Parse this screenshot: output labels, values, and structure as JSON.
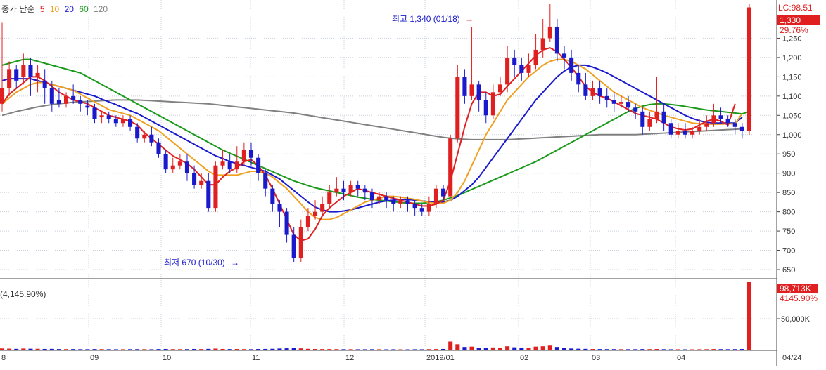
{
  "legend": {
    "label": "종가 단순",
    "periods": [
      {
        "text": "5",
        "color": "#e02020"
      },
      {
        "text": "10",
        "color": "#f0a020"
      },
      {
        "text": "20",
        "color": "#1a1acc"
      },
      {
        "text": "60",
        "color": "#1a9a1a"
      },
      {
        "text": "120",
        "color": "#808080"
      }
    ]
  },
  "annotations": {
    "high": "최고 1,340 (01/18)",
    "low": "최저 670 (10/30)"
  },
  "price_panel": {
    "lc_label": "LC:98.51",
    "current_price": "1,330",
    "current_change": "29.76%",
    "y_ticks": [
      "1,250",
      "1,200",
      "1,150",
      "1,100",
      "1,050",
      "1,000",
      "950",
      "900",
      "850",
      "800",
      "750",
      "700",
      "650"
    ]
  },
  "volume_panel": {
    "header": "(4,145.90%)",
    "current_volume": "98,713K",
    "current_ratio": "4145.90%",
    "y_tick": "50,000K"
  },
  "x_labels": [
    "8",
    "09",
    "10",
    "11",
    "12",
    "2019/01",
    "02",
    "03",
    "04",
    "04/24"
  ],
  "colors": {
    "up": "#e02020",
    "down": "#1a1acc",
    "ma5": "#e02020",
    "ma10": "#f0a020",
    "ma20": "#1a1acc",
    "ma60": "#1a9a1a",
    "ma120": "#808080",
    "grid": "#c8d0dc",
    "axis": "#444444",
    "price_box": "#e02020"
  },
  "chart_data": {
    "type": "candlestick",
    "y_range": [
      630,
      1340
    ],
    "volume_range": [
      0,
      100000
    ],
    "months": [
      "8",
      "09",
      "10",
      "11",
      "12",
      "2019/01",
      "02",
      "03",
      "04",
      "04/24"
    ],
    "candles": [
      [
        1080,
        1120,
        1290,
        1060,
        1800
      ],
      [
        1120,
        1170,
        1190,
        1100,
        1500
      ],
      [
        1170,
        1140,
        1180,
        1120,
        1200
      ],
      [
        1150,
        1180,
        1210,
        1130,
        1700
      ],
      [
        1180,
        1150,
        1200,
        1100,
        1400
      ],
      [
        1150,
        1160,
        1180,
        1110,
        1300
      ],
      [
        1140,
        1120,
        1170,
        1080,
        1100
      ],
      [
        1120,
        1080,
        1140,
        1060,
        1200
      ],
      [
        1090,
        1080,
        1120,
        1070,
        900
      ],
      [
        1080,
        1100,
        1110,
        1070,
        800
      ],
      [
        1100,
        1090,
        1130,
        1080,
        900
      ],
      [
        1090,
        1080,
        1100,
        1060,
        700
      ],
      [
        1075,
        1070,
        1090,
        1050,
        700
      ],
      [
        1070,
        1040,
        1080,
        1030,
        900
      ],
      [
        1045,
        1050,
        1060,
        1030,
        800
      ],
      [
        1050,
        1040,
        1060,
        1030,
        700
      ],
      [
        1040,
        1030,
        1050,
        1020,
        600
      ],
      [
        1030,
        1040,
        1050,
        1020,
        600
      ],
      [
        1040,
        1020,
        1050,
        1010,
        700
      ],
      [
        1020,
        990,
        1030,
        980,
        800
      ],
      [
        990,
        1000,
        1010,
        980,
        700
      ],
      [
        1000,
        980,
        1020,
        970,
        600
      ],
      [
        980,
        950,
        990,
        940,
        900
      ],
      [
        950,
        910,
        960,
        900,
        1000
      ],
      [
        910,
        920,
        940,
        900,
        800
      ],
      [
        920,
        930,
        950,
        910,
        700
      ],
      [
        930,
        900,
        950,
        880,
        800
      ],
      [
        900,
        870,
        920,
        860,
        1000
      ],
      [
        870,
        880,
        900,
        860,
        900
      ],
      [
        880,
        810,
        900,
        800,
        1200
      ],
      [
        810,
        920,
        930,
        800,
        1600
      ],
      [
        920,
        930,
        960,
        910,
        1100
      ],
      [
        930,
        910,
        950,
        900,
        900
      ],
      [
        910,
        930,
        970,
        900,
        1000
      ],
      [
        930,
        960,
        980,
        920,
        800
      ],
      [
        960,
        940,
        980,
        920,
        700
      ],
      [
        940,
        900,
        950,
        880,
        1000
      ],
      [
        900,
        860,
        910,
        840,
        1100
      ],
      [
        860,
        820,
        870,
        800,
        1300
      ],
      [
        820,
        800,
        830,
        760,
        1700
      ],
      [
        800,
        740,
        810,
        720,
        2000
      ],
      [
        740,
        680,
        760,
        670,
        2400
      ],
      [
        680,
        760,
        780,
        670,
        1900
      ],
      [
        760,
        790,
        810,
        750,
        1300
      ],
      [
        790,
        800,
        830,
        780,
        1000
      ],
      [
        800,
        820,
        840,
        790,
        900
      ],
      [
        820,
        850,
        870,
        810,
        900
      ],
      [
        850,
        860,
        890,
        840,
        800
      ],
      [
        860,
        850,
        880,
        830,
        700
      ],
      [
        850,
        870,
        880,
        840,
        700
      ],
      [
        870,
        860,
        880,
        840,
        600
      ],
      [
        860,
        850,
        870,
        830,
        600
      ],
      [
        850,
        830,
        860,
        810,
        700
      ],
      [
        830,
        840,
        850,
        820,
        600
      ],
      [
        840,
        830,
        850,
        810,
        500
      ],
      [
        830,
        820,
        840,
        800,
        600
      ],
      [
        820,
        830,
        840,
        810,
        500
      ],
      [
        830,
        820,
        840,
        800,
        500
      ],
      [
        820,
        810,
        830,
        790,
        600
      ],
      [
        810,
        800,
        820,
        790,
        600
      ],
      [
        800,
        820,
        840,
        790,
        800
      ],
      [
        820,
        860,
        870,
        810,
        900
      ],
      [
        860,
        840,
        870,
        830,
        1100
      ],
      [
        840,
        990,
        1000,
        840,
        12000
      ],
      [
        990,
        1150,
        1180,
        980,
        8000
      ],
      [
        1150,
        1100,
        1170,
        1080,
        4000
      ],
      [
        1100,
        1130,
        1280,
        1090,
        4500
      ],
      [
        1130,
        1090,
        1140,
        1060,
        3000
      ],
      [
        1090,
        1050,
        1110,
        1030,
        2500
      ],
      [
        1050,
        1110,
        1130,
        1040,
        3300
      ],
      [
        1110,
        1130,
        1150,
        1100,
        2200
      ],
      [
        1130,
        1200,
        1230,
        1110,
        5000
      ],
      [
        1200,
        1180,
        1220,
        1150,
        3500
      ],
      [
        1180,
        1160,
        1200,
        1140,
        2500
      ],
      [
        1160,
        1180,
        1210,
        1150,
        2200
      ],
      [
        1180,
        1220,
        1260,
        1170,
        4500
      ],
      [
        1220,
        1250,
        1300,
        1200,
        5000
      ],
      [
        1250,
        1280,
        1340,
        1240,
        6000
      ],
      [
        1280,
        1210,
        1300,
        1190,
        4000
      ],
      [
        1210,
        1200,
        1230,
        1170,
        2200
      ],
      [
        1200,
        1160,
        1220,
        1140,
        1700
      ],
      [
        1160,
        1130,
        1180,
        1110,
        1400
      ],
      [
        1130,
        1100,
        1160,
        1090,
        1200
      ],
      [
        1100,
        1120,
        1140,
        1090,
        1000
      ],
      [
        1120,
        1100,
        1140,
        1080,
        900
      ],
      [
        1100,
        1090,
        1120,
        1070,
        800
      ],
      [
        1090,
        1080,
        1110,
        1060,
        800
      ],
      [
        1080,
        1085,
        1100,
        1070,
        700
      ],
      [
        1085,
        1070,
        1100,
        1060,
        700
      ],
      [
        1070,
        1060,
        1080,
        1040,
        700
      ],
      [
        1060,
        1020,
        1070,
        1000,
        900
      ],
      [
        1020,
        1040,
        1060,
        1010,
        800
      ],
      [
        1040,
        1060,
        1150,
        1030,
        1000
      ],
      [
        1060,
        1030,
        1080,
        1010,
        700
      ],
      [
        1030,
        1000,
        1040,
        990,
        600
      ],
      [
        1000,
        1010,
        1030,
        990,
        600
      ],
      [
        1010,
        1000,
        1030,
        990,
        500
      ],
      [
        1000,
        1010,
        1020,
        990,
        500
      ],
      [
        1010,
        1020,
        1040,
        1000,
        600
      ],
      [
        1020,
        1030,
        1050,
        1010,
        700
      ],
      [
        1030,
        1050,
        1080,
        1020,
        900
      ],
      [
        1050,
        1040,
        1070,
        1030,
        800
      ],
      [
        1040,
        1030,
        1050,
        1020,
        700
      ],
      [
        1030,
        1020,
        1040,
        1000,
        800
      ],
      [
        1020,
        1010,
        1030,
        990,
        1000
      ],
      [
        1010,
        1330,
        1340,
        1000,
        98713
      ]
    ],
    "ma5": [
      1080,
      1105,
      1120,
      1135,
      1150,
      1150,
      1140,
      1125,
      1110,
      1100,
      1090,
      1085,
      1080,
      1070,
      1060,
      1050,
      1045,
      1040,
      1035,
      1025,
      1005,
      990,
      975,
      960,
      945,
      935,
      925,
      910,
      890,
      870,
      870,
      890,
      905,
      915,
      930,
      935,
      920,
      895,
      860,
      820,
      780,
      740,
      725,
      730,
      755,
      790,
      810,
      825,
      840,
      850,
      860,
      855,
      850,
      845,
      840,
      835,
      830,
      825,
      820,
      815,
      815,
      820,
      830,
      880,
      950,
      1020,
      1080,
      1110,
      1110,
      1100,
      1105,
      1125,
      1145,
      1165,
      1185,
      1205,
      1220,
      1225,
      1215,
      1195,
      1175,
      1150,
      1125,
      1110,
      1100,
      1095,
      1085,
      1075,
      1065,
      1055,
      1050,
      1045,
      1040,
      1030,
      1020,
      1015,
      1012,
      1015,
      1025,
      1035,
      1040,
      1035,
      1025,
      1080
    ],
    "ma10": [
      1080,
      1095,
      1110,
      1120,
      1130,
      1135,
      1135,
      1130,
      1125,
      1120,
      1115,
      1105,
      1095,
      1085,
      1075,
      1065,
      1060,
      1055,
      1050,
      1040,
      1030,
      1020,
      1010,
      995,
      980,
      965,
      950,
      935,
      920,
      905,
      895,
      895,
      895,
      895,
      900,
      905,
      905,
      900,
      890,
      875,
      860,
      840,
      820,
      800,
      785,
      780,
      780,
      785,
      795,
      805,
      815,
      825,
      830,
      835,
      840,
      840,
      838,
      835,
      832,
      828,
      824,
      822,
      822,
      830,
      850,
      880,
      920,
      960,
      1000,
      1030,
      1060,
      1090,
      1110,
      1130,
      1150,
      1165,
      1180,
      1190,
      1195,
      1195,
      1190,
      1180,
      1170,
      1155,
      1140,
      1125,
      1110,
      1100,
      1090,
      1080,
      1070,
      1063,
      1057,
      1050,
      1045,
      1040,
      1035,
      1030,
      1028,
      1027,
      1027,
      1027,
      1028,
      1028,
      1055
    ],
    "ma20": [
      1140,
      1145,
      1145,
      1145,
      1145,
      1140,
      1135,
      1130,
      1125,
      1120,
      1115,
      1110,
      1105,
      1100,
      1092,
      1085,
      1078,
      1070,
      1062,
      1055,
      1045,
      1035,
      1025,
      1015,
      1005,
      995,
      985,
      975,
      965,
      955,
      945,
      938,
      930,
      925,
      920,
      915,
      910,
      905,
      895,
      885,
      870,
      855,
      840,
      825,
      812,
      805,
      800,
      800,
      802,
      805,
      810,
      815,
      820,
      825,
      828,
      830,
      832,
      832,
      830,
      828,
      826,
      825,
      825,
      830,
      840,
      855,
      870,
      890,
      915,
      940,
      965,
      990,
      1015,
      1040,
      1065,
      1090,
      1110,
      1130,
      1150,
      1165,
      1175,
      1180,
      1180,
      1175,
      1168,
      1160,
      1150,
      1140,
      1130,
      1120,
      1110,
      1100,
      1090,
      1080,
      1070,
      1060,
      1050,
      1042,
      1036,
      1032,
      1030,
      1030,
      1030,
      1030,
      1045
    ],
    "ma60": [
      1180,
      1185,
      1190,
      1195,
      1195,
      1190,
      1185,
      1180,
      1175,
      1170,
      1165,
      1160,
      1150,
      1140,
      1130,
      1120,
      1110,
      1100,
      1090,
      1080,
      1070,
      1060,
      1050,
      1040,
      1030,
      1020,
      1010,
      1000,
      990,
      980,
      970,
      960,
      952,
      944,
      936,
      928,
      920,
      912,
      904,
      896,
      888,
      880,
      874,
      868,
      862,
      858,
      854,
      850,
      846,
      842,
      838,
      835,
      832,
      830,
      828,
      826,
      824,
      822,
      822,
      822,
      824,
      826,
      830,
      836,
      842,
      850,
      858,
      866,
      874,
      882,
      890,
      898,
      906,
      914,
      922,
      930,
      940,
      950,
      960,
      970,
      980,
      990,
      1000,
      1010,
      1020,
      1030,
      1040,
      1050,
      1060,
      1068,
      1074,
      1078,
      1080,
      1080,
      1078,
      1076,
      1073,
      1070,
      1067,
      1064,
      1062,
      1060,
      1058,
      1056,
      1054,
      1060
    ],
    "ma120": [
      1050,
      1055,
      1060,
      1064,
      1068,
      1072,
      1075,
      1078,
      1080,
      1082,
      1084,
      1085,
      1086,
      1087,
      1088,
      1089,
      1090,
      1090,
      1090,
      1090,
      1089,
      1088,
      1087,
      1086,
      1085,
      1084,
      1083,
      1082,
      1081,
      1080,
      1078,
      1076,
      1074,
      1072,
      1070,
      1068,
      1066,
      1064,
      1062,
      1060,
      1058,
      1056,
      1053,
      1050,
      1047,
      1044,
      1041,
      1038,
      1035,
      1032,
      1029,
      1026,
      1023,
      1020,
      1017,
      1014,
      1011,
      1008,
      1005,
      1002,
      999,
      996,
      993,
      991,
      989,
      988,
      987,
      987,
      987,
      987,
      987,
      987,
      988,
      989,
      990,
      991,
      992,
      993,
      994,
      995,
      996,
      997,
      998,
      999,
      1000,
      1000,
      1000,
      1000,
      1000,
      1000,
      1001,
      1002,
      1003,
      1004,
      1005,
      1006,
      1007,
      1008,
      1009,
      1010,
      1011,
      1012,
      1013,
      1014,
      1015
    ]
  }
}
